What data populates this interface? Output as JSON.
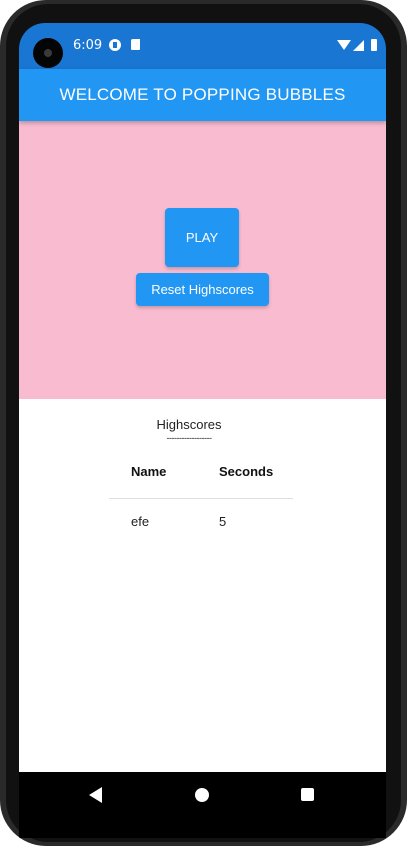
{
  "status_bar": {
    "time": "6:09",
    "icons": [
      "camera-icon",
      "notification-icon",
      "sd-card-icon",
      "wifi-icon",
      "signal-icon",
      "battery-icon"
    ]
  },
  "app_bar": {
    "title": "WELCOME TO POPPING BUBBLES",
    "color": "#2196f3"
  },
  "game_area": {
    "background": "#f8bbd0",
    "play_label": "PLAY",
    "reset_label": "Reset Highscores"
  },
  "highscores": {
    "title": "Highscores",
    "divider": "------------------",
    "columns": [
      "Name",
      "Seconds"
    ],
    "rows": [
      {
        "name": "efe",
        "seconds": "5"
      }
    ]
  },
  "nav_bar": {
    "icons": [
      "back-icon",
      "home-icon",
      "recent-apps-icon"
    ]
  }
}
